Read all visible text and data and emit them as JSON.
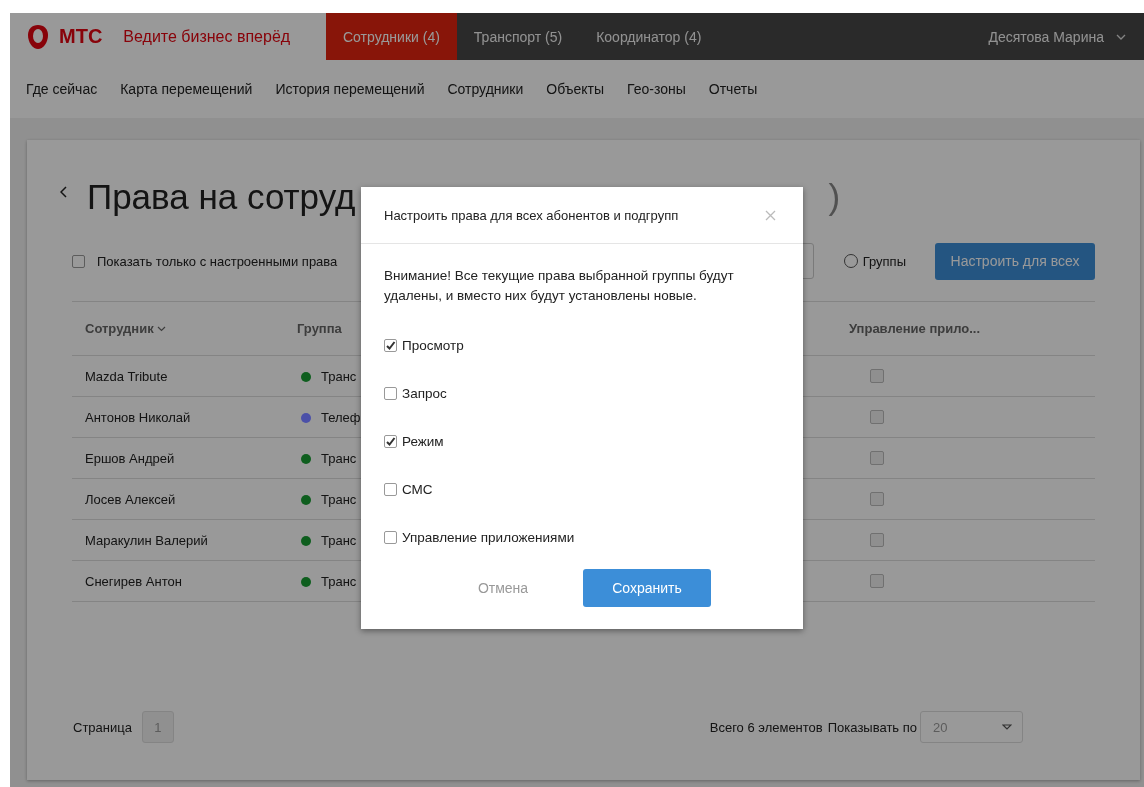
{
  "header": {
    "logo_text": "МТС",
    "slogan": "Ведите бизнес вперёд",
    "tabs": [
      {
        "label": "Сотрудники (4)",
        "selected": true
      },
      {
        "label": "Транспорт (5)",
        "selected": false
      },
      {
        "label": "Координатор (4)",
        "selected": false
      }
    ],
    "user": "Десятова Марина"
  },
  "nav": [
    "Где сейчас",
    "Карта перемещений",
    "История перемещений",
    "Сотрудники",
    "Объекты",
    "Гео-зоны",
    "Отчеты"
  ],
  "page": {
    "title_fragments": [
      "Права на сотруд",
      ")"
    ],
    "filter": {
      "label": "Показать только с настроенными права",
      "checked": false
    },
    "radio": {
      "label": "Группы",
      "selected": false
    },
    "configure_button": "Настроить для всех"
  },
  "table": {
    "columns": [
      "Сотрудник",
      "Группа",
      "Управление прило..."
    ],
    "rows": [
      {
        "name": "Mazda Tribute",
        "group": "Транс",
        "color": "#0e5e1e",
        "app_control": false
      },
      {
        "name": "Антонов Николай",
        "group": "Телеф",
        "color": "#4b50a8",
        "app_control": false
      },
      {
        "name": "Ершов Андрей",
        "group": "Транс",
        "color": "#0e5e1e",
        "app_control": false
      },
      {
        "name": "Лосев Алексей",
        "group": "Транс",
        "color": "#0e5e1e",
        "app_control": false
      },
      {
        "name": "Маракулин Валерий",
        "group": "Транс",
        "color": "#0e5e1e",
        "app_control": false
      },
      {
        "name": "Снегирев Антон",
        "group": "Транс",
        "color": "#0e5e1e",
        "app_control": false
      }
    ]
  },
  "pagination": {
    "label": "Страница",
    "page": "1",
    "total": "Всего 6 элементов",
    "per_page_label": "Показывать по",
    "per_page": "20"
  },
  "dialog": {
    "title": "Настроить права для всех абонентов и подгрупп",
    "message": "Внимание! Все текущие права выбранной группы будут удалены, и вместо них будут установлены новые.",
    "options": [
      {
        "label": "Просмотр",
        "checked": true
      },
      {
        "label": "Запрос",
        "checked": false
      },
      {
        "label": "Режим",
        "checked": true
      },
      {
        "label": "СМС",
        "checked": false
      },
      {
        "label": "Управление приложениями",
        "checked": false
      }
    ],
    "buttons": [
      {
        "label": "Отмена",
        "kind": "link"
      },
      {
        "label": "Сохранить",
        "kind": "primary"
      }
    ]
  }
}
